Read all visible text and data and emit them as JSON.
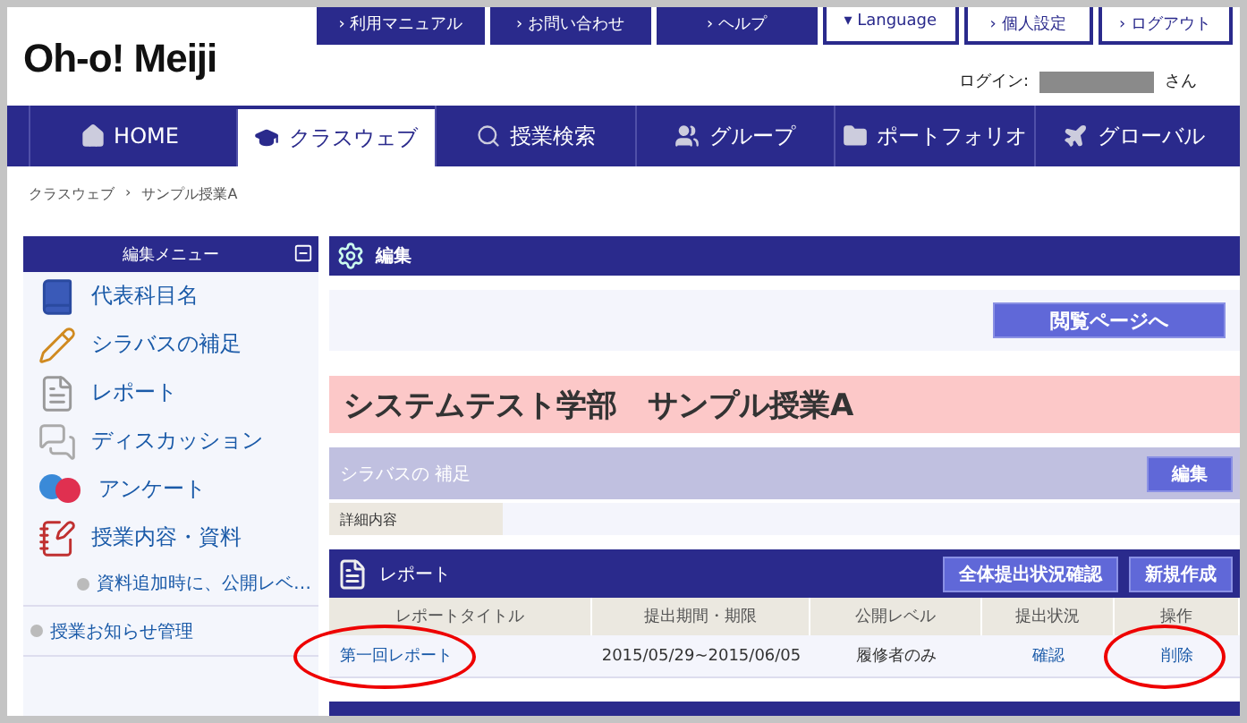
{
  "header": {
    "logo": "Oh-o! Meiji",
    "top_links": [
      {
        "label": "› 利用マニュアル",
        "kind": "dark"
      },
      {
        "label": "› お問い合わせ",
        "kind": "dark"
      },
      {
        "label": "› ヘルプ",
        "kind": "dark"
      },
      {
        "label": "▾ Language",
        "kind": "light"
      },
      {
        "label": "› 個人設定",
        "kind": "light"
      },
      {
        "label": "› ログアウト",
        "kind": "light"
      }
    ],
    "login_label": "ログイン:",
    "login_suffix": "さん"
  },
  "nav_tabs": [
    {
      "label": "HOME",
      "selected": false
    },
    {
      "label": "クラスウェブ",
      "selected": true
    },
    {
      "label": "授業検索",
      "selected": false
    },
    {
      "label": "グループ",
      "selected": false
    },
    {
      "label": "ポートフォリオ",
      "selected": false
    },
    {
      "label": "グローバル",
      "selected": false
    }
  ],
  "breadcrumb": {
    "items": [
      "クラスウェブ",
      "サンプル授業A"
    ],
    "separator": "›"
  },
  "sidebar": {
    "title": "編集メニュー",
    "items": [
      {
        "label": "代表科目名",
        "kind": "main"
      },
      {
        "label": "シラバスの補足",
        "kind": "main"
      },
      {
        "label": "レポート",
        "kind": "main"
      },
      {
        "label": "ディスカッション",
        "kind": "main"
      },
      {
        "label": "アンケート",
        "kind": "main"
      },
      {
        "label": "授業内容・資料",
        "kind": "main"
      },
      {
        "label": "資料追加時に、公開レベ…",
        "kind": "sub"
      },
      {
        "label": "授業お知らせ管理",
        "kind": "bullet"
      }
    ]
  },
  "edit_panel": {
    "title": "編集",
    "button": "閲覧ページへ"
  },
  "course_title": "システムテスト学部　サンプル授業A",
  "syllabus": {
    "title": "シラバスの 補足",
    "button": "編集",
    "field_label": "詳細内容"
  },
  "report": {
    "title": "レポート",
    "buttons": [
      "全体提出状況確認",
      "新規作成"
    ],
    "columns": [
      "レポートタイトル",
      "提出期間・期限",
      "公開レベル",
      "提出状況",
      "操作"
    ],
    "rows": [
      {
        "cells": [
          {
            "text": "第一回レポート",
            "kind": "link",
            "circled": true
          },
          {
            "text": "2015/05/29~2015/06/05",
            "kind": "text",
            "circled": false
          },
          {
            "text": "履修者のみ",
            "kind": "text",
            "circled": false
          },
          {
            "text": "確認",
            "kind": "link",
            "circled": false
          },
          {
            "text": "削除",
            "kind": "link",
            "circled": true
          }
        ]
      }
    ]
  }
}
